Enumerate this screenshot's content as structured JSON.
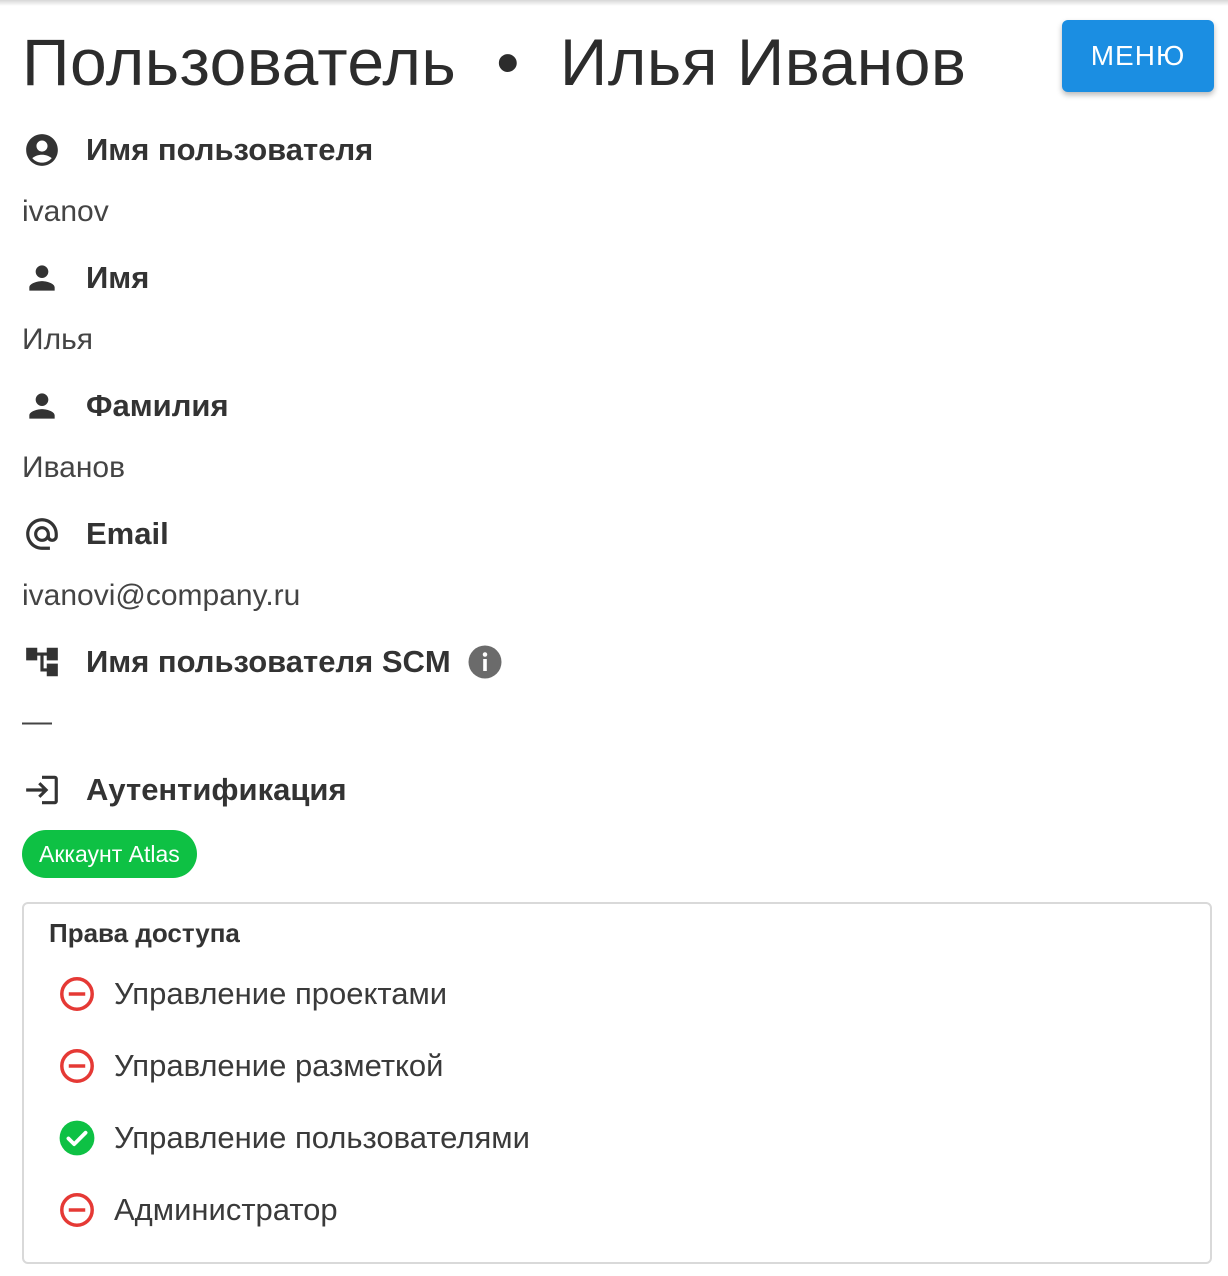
{
  "header": {
    "title_prefix": "Пользователь",
    "separator": "•",
    "title_name": "Илья Иванов",
    "menu_label": "МЕНЮ"
  },
  "fields": [
    {
      "label": "Имя пользователя",
      "value": "ivanov",
      "icon": "account-circle-icon"
    },
    {
      "label": "Имя",
      "value": "Илья",
      "icon": "person-icon"
    },
    {
      "label": "Фамилия",
      "value": "Иванов",
      "icon": "person-icon"
    },
    {
      "label": "Email",
      "value": "ivanovi@company.ru",
      "icon": "at-sign-icon"
    },
    {
      "label": "Имя пользователя SCM",
      "value": "—",
      "icon": "scm-tree-icon",
      "info_icon": "info-icon"
    },
    {
      "label": "Аутентификация",
      "icon": "login-icon"
    }
  ],
  "auth_chip": "Аккаунт Atlas",
  "permissions": {
    "title": "Права доступа",
    "items": [
      {
        "label": "Управление проектами",
        "granted": false
      },
      {
        "label": "Управление разметкой",
        "granted": false
      },
      {
        "label": "Управление пользователями",
        "granted": true
      },
      {
        "label": "Администратор",
        "granted": false
      }
    ]
  },
  "colors": {
    "accent": "#1b8ee2",
    "granted": "#0ec144",
    "denied": "#e53935"
  }
}
